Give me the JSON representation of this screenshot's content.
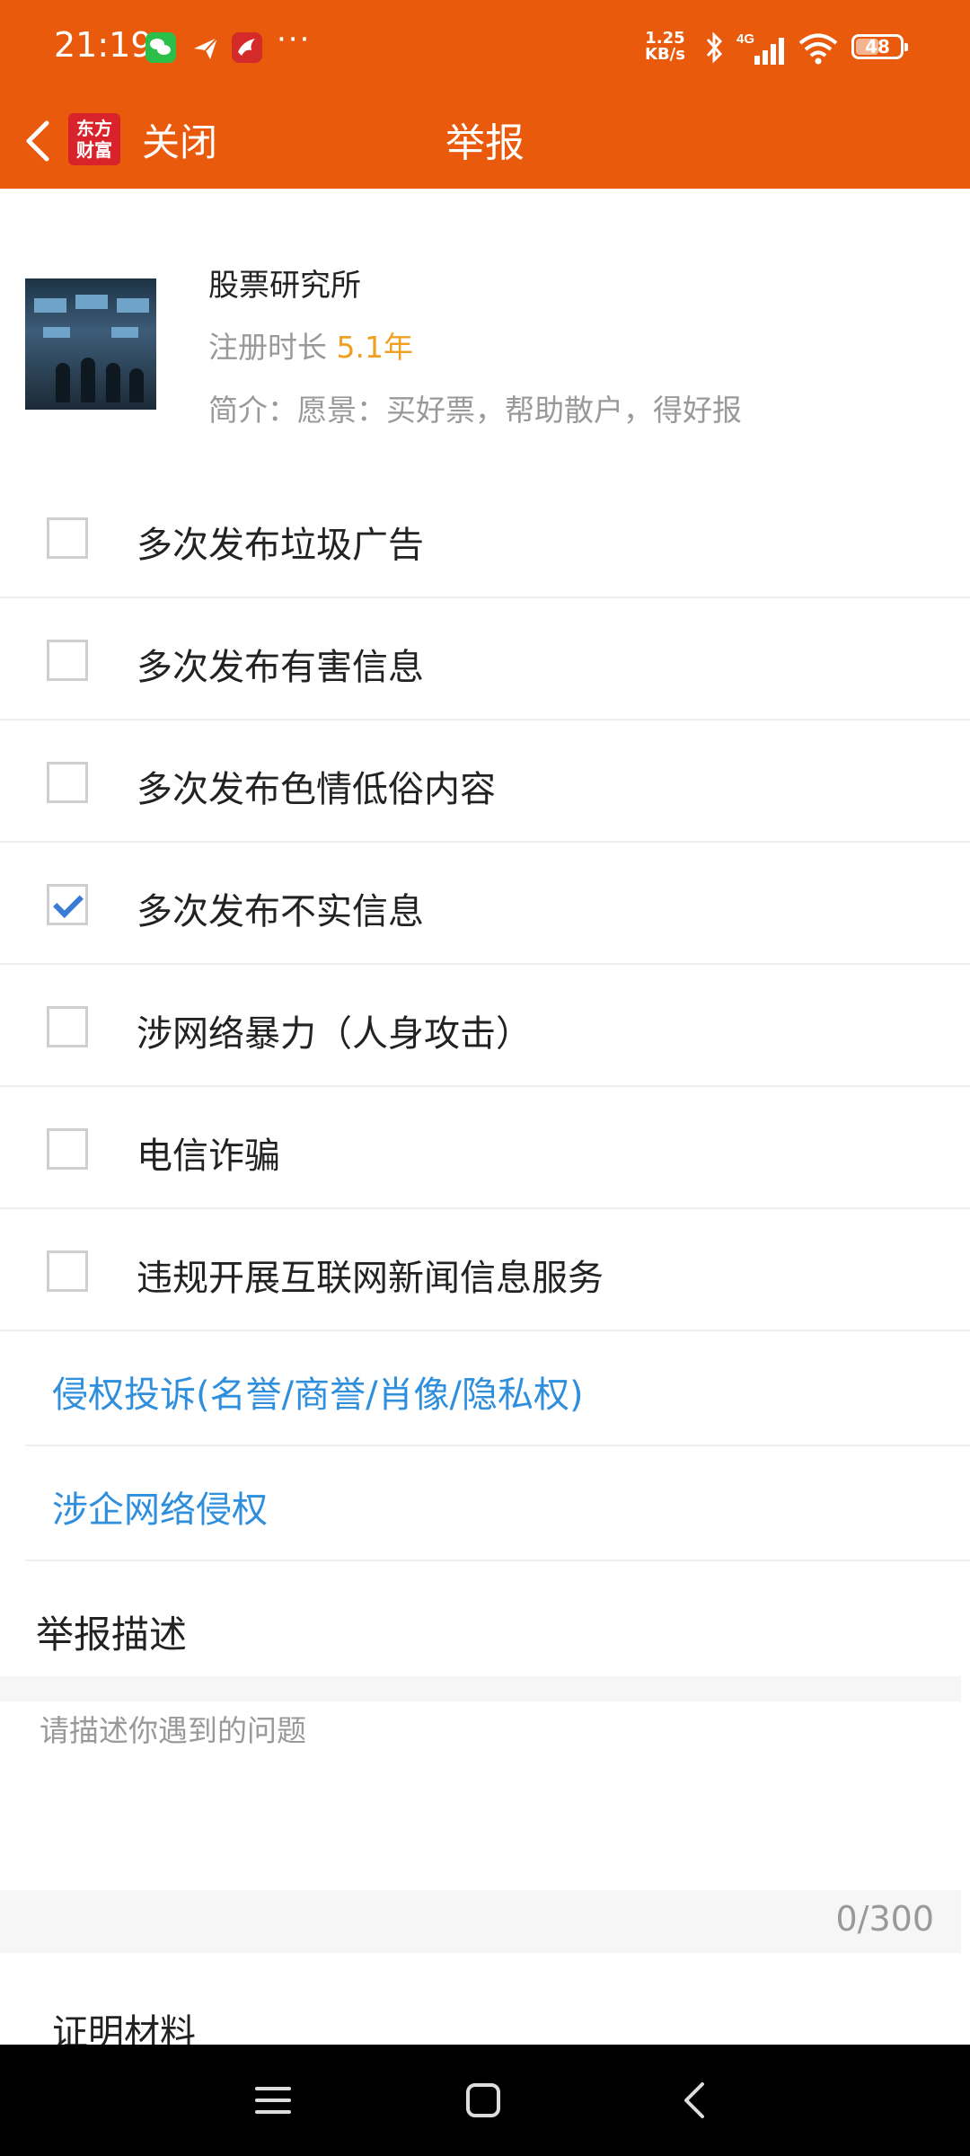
{
  "status_bar": {
    "time": "21:19",
    "more": "···",
    "speed_line1": "1.25",
    "speed_line2": "KB/s",
    "network": "4G",
    "battery": "48",
    "battery_level": 0.48
  },
  "app_bar": {
    "logo_line1": "东方",
    "logo_line2": "财富",
    "close_label": "关闭",
    "title": "举报"
  },
  "profile": {
    "name": "股票研究所",
    "reg_prefix": "注册时长 ",
    "reg_years": "5.1年",
    "bio": "简介：愿景：买好票，帮助散户，得好报"
  },
  "reasons": [
    {
      "label": "多次发布垃圾广告",
      "checked": false
    },
    {
      "label": "多次发布有害信息",
      "checked": false
    },
    {
      "label": "多次发布色情低俗内容",
      "checked": false
    },
    {
      "label": "多次发布不实信息",
      "checked": true
    },
    {
      "label": "涉网络暴力（人身攻击）",
      "checked": false
    },
    {
      "label": "电信诈骗",
      "checked": false
    },
    {
      "label": "违规开展互联网新闻信息服务",
      "checked": false
    }
  ],
  "links": [
    {
      "label": "侵权投诉(名誉/商誉/肖像/隐私权)"
    },
    {
      "label": "涉企网络侵权"
    }
  ],
  "description": {
    "title": "举报描述",
    "placeholder": "请描述你遇到的问题",
    "counter": "0/300"
  },
  "proof": {
    "title": "证明材料"
  },
  "colors": {
    "header": "#e95a0c",
    "link": "#2f8fdc",
    "years": "#f0a020",
    "check": "#3a7bd5"
  }
}
